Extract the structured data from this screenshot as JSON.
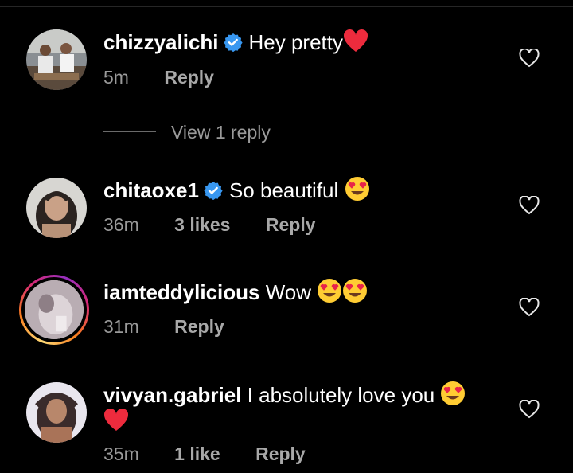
{
  "comments": [
    {
      "username": "chizzyalichi",
      "verified": true,
      "text": "Hey pretty",
      "time": "5m",
      "likes": "",
      "reply": "Reply",
      "view_replies": "View 1 reply"
    },
    {
      "username": "chitaoxe1",
      "verified": true,
      "text": "So beautiful",
      "time": "36m",
      "likes": "3 likes",
      "reply": "Reply"
    },
    {
      "username": "iamteddylicious",
      "verified": false,
      "text": "Wow",
      "time": "31m",
      "likes": "",
      "reply": "Reply"
    },
    {
      "username": "vivyan.gabriel",
      "verified": false,
      "text": "I absolutely love you",
      "time": "35m",
      "likes": "1 like",
      "reply": "Reply"
    }
  ],
  "colors": {
    "background": "#000000",
    "verified": "#3897f0",
    "heart": "#ed2b3d",
    "meta": "#9a9a9a"
  },
  "icons": [
    "verified-badge-icon",
    "heart-outline-icon",
    "heart-eyes-emoji",
    "red-heart-emoji"
  ]
}
